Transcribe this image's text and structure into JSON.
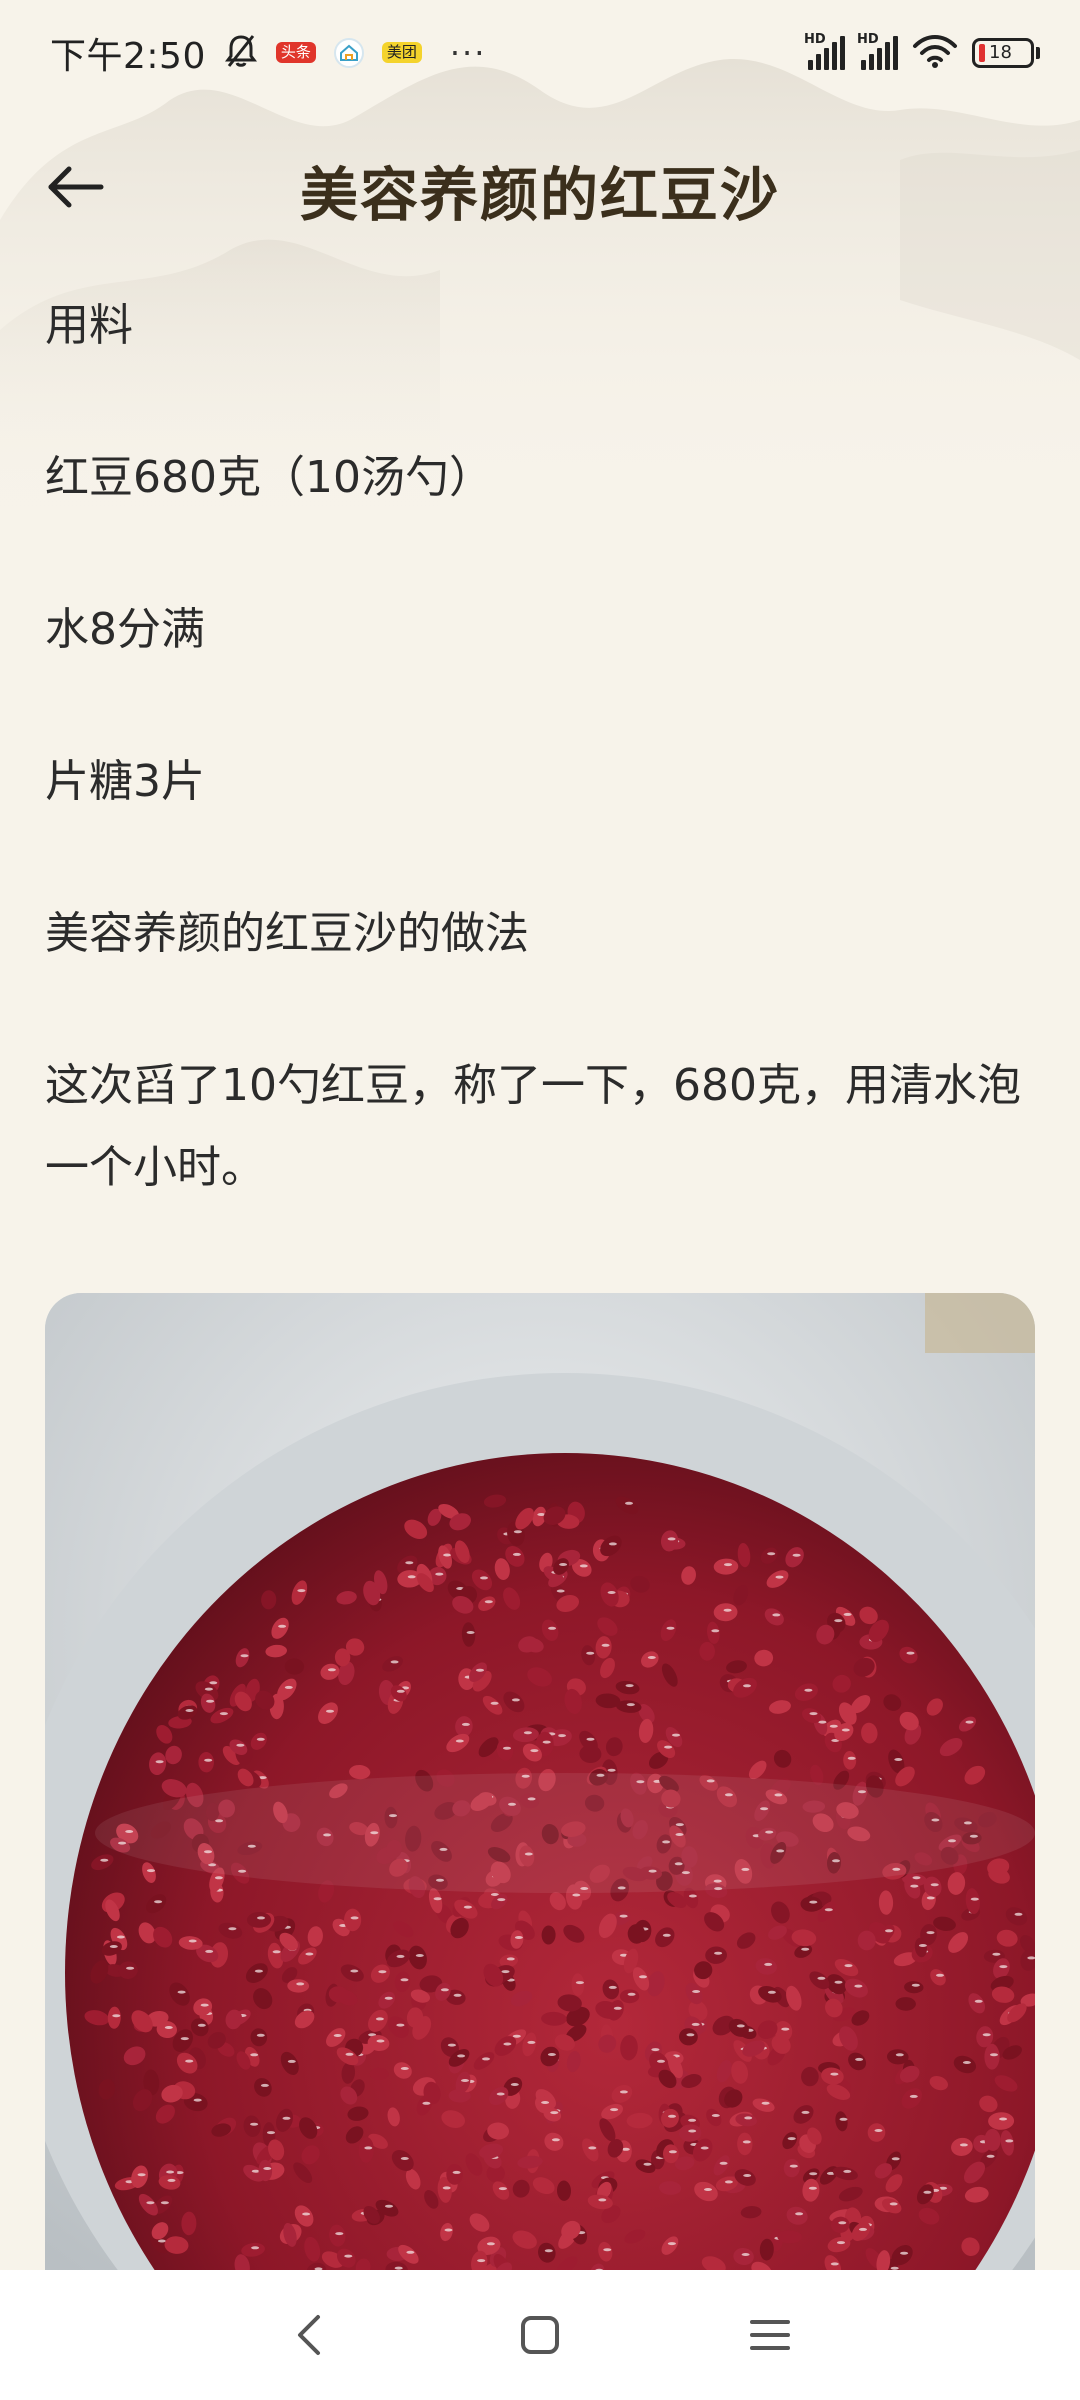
{
  "status_bar": {
    "time": "下午2:50",
    "badges": {
      "toutiao": "头条",
      "meituan": "美团"
    },
    "more": "···",
    "signal_label": "HD",
    "battery": "18",
    "icons": [
      "mute-bell-icon",
      "toutiao-app-icon",
      "home-app-icon",
      "meituan-app-icon",
      "signal-icon",
      "wifi-icon",
      "battery-icon"
    ]
  },
  "header": {
    "title": "美容养颜的红豆沙",
    "back_icon": "back-arrow-icon"
  },
  "content": {
    "paragraphs": [
      "用料",
      "红豆680克（10汤勺）",
      "水8分满",
      "片糖3片",
      "美容养颜的红豆沙的做法",
      "这次舀了10勺红豆，称了一下，680克，用清水泡一个小时。"
    ],
    "image": "soaked-red-beans-photo"
  },
  "nav_bar": {
    "icons": [
      "back-chevron-icon",
      "home-square-icon",
      "menu-lines-icon"
    ]
  },
  "colors": {
    "background": "#f7f3ea",
    "title": "#3b2f1c",
    "text": "#2b2b2b"
  }
}
